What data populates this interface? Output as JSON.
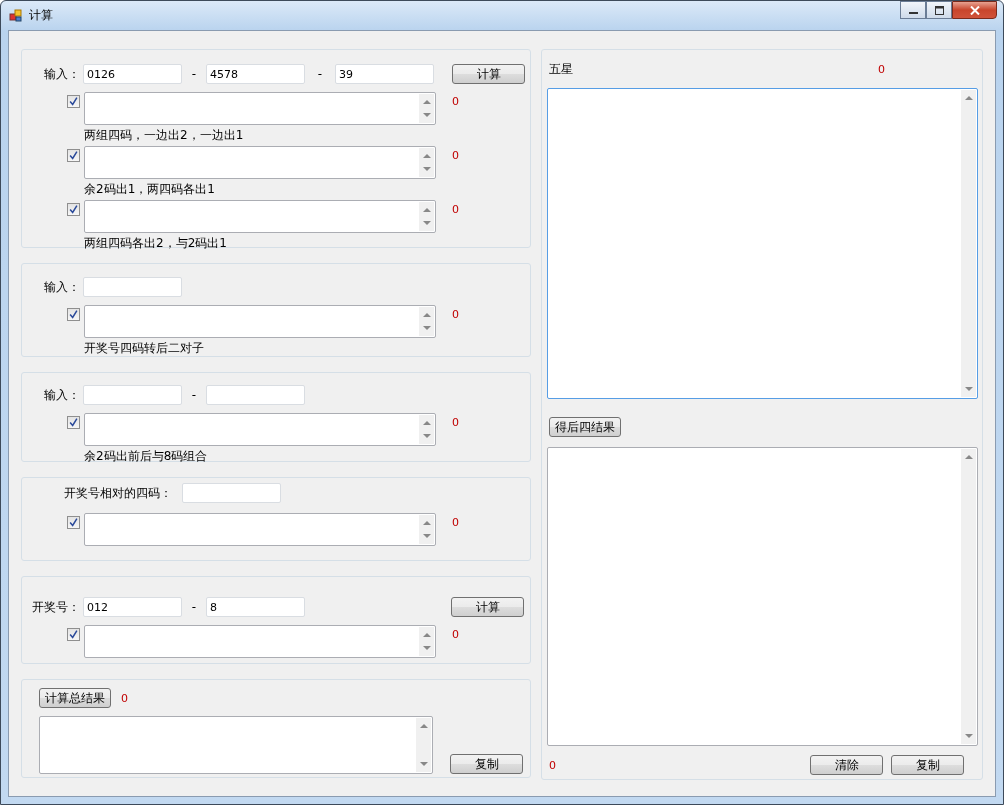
{
  "window": {
    "title": "计算"
  },
  "groups": [
    {
      "kind": "inputs",
      "label": "输入：",
      "fields": [
        {
          "kind": "text",
          "value": "0126"
        },
        {
          "kind": "text",
          "value": "4578"
        },
        {
          "kind": "text",
          "value": "39"
        }
      ],
      "separators": [
        "-",
        "-"
      ],
      "button": "计算",
      "rows": [
        {
          "checked": true,
          "count": "0",
          "caption": "两组四码，一边出2，一边出1"
        },
        {
          "checked": true,
          "count": "0",
          "caption": "余2码出1，两四码各出1"
        },
        {
          "checked": true,
          "count": "0",
          "caption": "两组四码各出2，与2码出1"
        }
      ]
    },
    {
      "kind": "inputs",
      "label": "输入：",
      "fields": [
        {
          "kind": "text"
        }
      ],
      "rows": [
        {
          "checked": true,
          "count": "0",
          "caption": "开奖号四码转后二对子"
        }
      ]
    },
    {
      "kind": "inputs",
      "label": "输入：",
      "fields": [
        {
          "kind": "text"
        },
        {
          "kind": "text"
        }
      ],
      "separators": [
        "-"
      ],
      "rows": [
        {
          "checked": true,
          "count": "0",
          "caption": "余2码出前后与8码组合"
        }
      ]
    },
    {
      "kind": "wide-label",
      "label": "开奖号相对的四码：",
      "fields": [
        {
          "kind": "text"
        }
      ],
      "rows": [
        {
          "checked": true,
          "count": "0"
        }
      ]
    },
    {
      "kind": "inputs",
      "label": "开奖号：",
      "fields": [
        {
          "kind": "text",
          "value": "012"
        },
        {
          "kind": "text",
          "value": "8"
        }
      ],
      "separators": [
        "-"
      ],
      "button": "计算",
      "rows": [
        {
          "checked": true,
          "count": "0"
        }
      ]
    },
    {
      "kind": "total",
      "button": "计算总结果",
      "count": "0",
      "copy_button": "复制"
    }
  ],
  "right_panel": {
    "title": "五星",
    "count": "0",
    "result_button": "得后四结果",
    "bottom_count": "0",
    "buttons": [
      "清除",
      "复制"
    ]
  }
}
